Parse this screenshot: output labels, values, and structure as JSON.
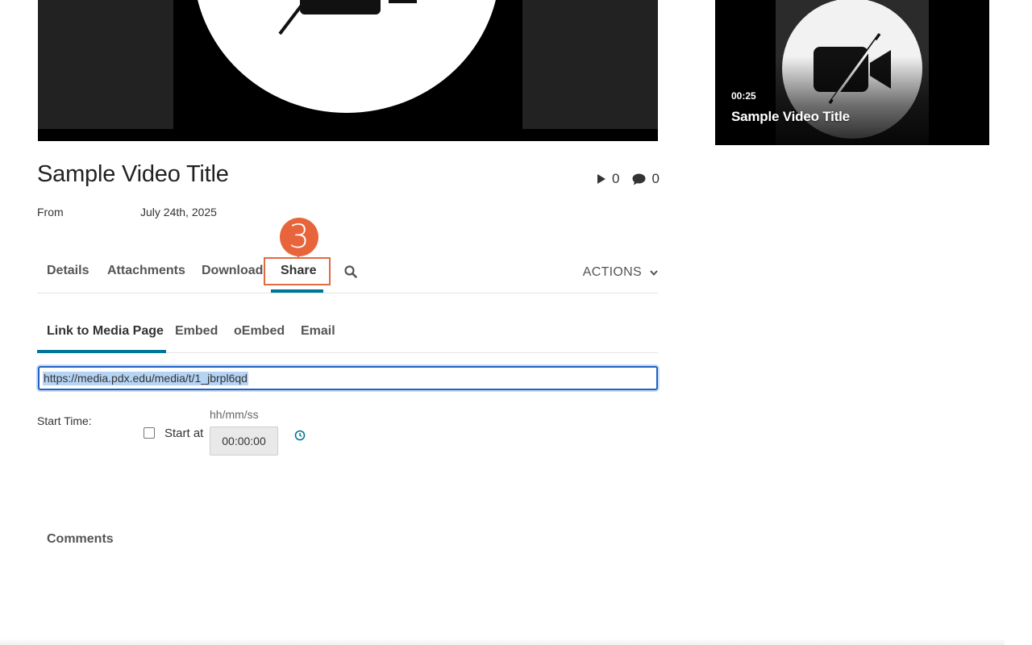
{
  "player": {
    "icon": "video-off-icon"
  },
  "video": {
    "title": "Sample Video Title",
    "plays": "0",
    "comments_count": "0",
    "from_label": "From",
    "date": "July 24th, 2025"
  },
  "callout": {
    "number": "3",
    "color": "#e8653b"
  },
  "tabs": {
    "details": "Details",
    "attachments": "Attachments",
    "download": "Download",
    "share": "Share",
    "actions": "ACTIONS"
  },
  "share": {
    "subtabs": {
      "link": "Link to Media Page",
      "embed": "Embed",
      "oembed": "oEmbed",
      "email": "Email"
    },
    "link_url": "https://media.pdx.edu/media/t/1_jbrpl6qd",
    "start_time_label": "Start Time:",
    "time_format_hint": "hh/mm/ss",
    "start_at_label": "Start at",
    "start_at_checked": false,
    "time_value": "00:00:00"
  },
  "comments": {
    "heading": "Comments"
  },
  "related": {
    "duration": "00:25",
    "title": "Sample Video Title"
  },
  "colors": {
    "accent": "#00759a",
    "highlight_box": "#e06a42",
    "focus": "#1e63c4"
  }
}
